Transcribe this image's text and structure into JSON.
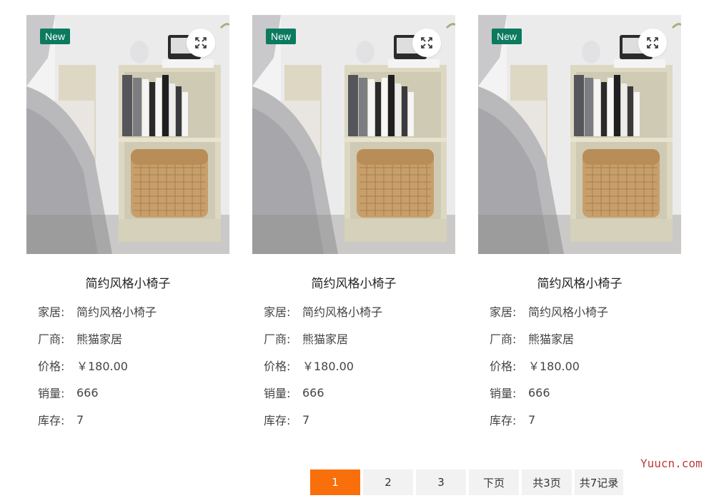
{
  "products": [
    {
      "badge": "New",
      "title": "简约风格小椅子",
      "fields": [
        {
          "label": "家居:",
          "value": "简约风格小椅子"
        },
        {
          "label": "厂商:",
          "value": "熊猫家居"
        },
        {
          "label": "价格:",
          "value": "￥180.00"
        },
        {
          "label": "销量:",
          "value": "666"
        },
        {
          "label": "库存:",
          "value": "7"
        }
      ]
    },
    {
      "badge": "New",
      "title": "简约风格小椅子",
      "fields": [
        {
          "label": "家居:",
          "value": "简约风格小椅子"
        },
        {
          "label": "厂商:",
          "value": "熊猫家居"
        },
        {
          "label": "价格:",
          "value": "￥180.00"
        },
        {
          "label": "销量:",
          "value": "666"
        },
        {
          "label": "库存:",
          "value": "7"
        }
      ]
    },
    {
      "badge": "New",
      "title": "简约风格小椅子",
      "fields": [
        {
          "label": "家居:",
          "value": "简约风格小椅子"
        },
        {
          "label": "厂商:",
          "value": "熊猫家居"
        },
        {
          "label": "价格:",
          "value": "￥180.00"
        },
        {
          "label": "销量:",
          "value": "666"
        },
        {
          "label": "库存:",
          "value": "7"
        }
      ]
    }
  ],
  "pagination": {
    "pages": [
      "1",
      "2",
      "3"
    ],
    "current": "1",
    "next_label": "下页",
    "total_pages": "共3页",
    "total_records": "共7记录"
  },
  "watermark": "Yuucn.com",
  "colors": {
    "badge": "#0b7a5e",
    "active_page": "#f86f0c",
    "page_bg": "#f2f2f2"
  },
  "icons": {
    "zoom": "expand-icon"
  }
}
